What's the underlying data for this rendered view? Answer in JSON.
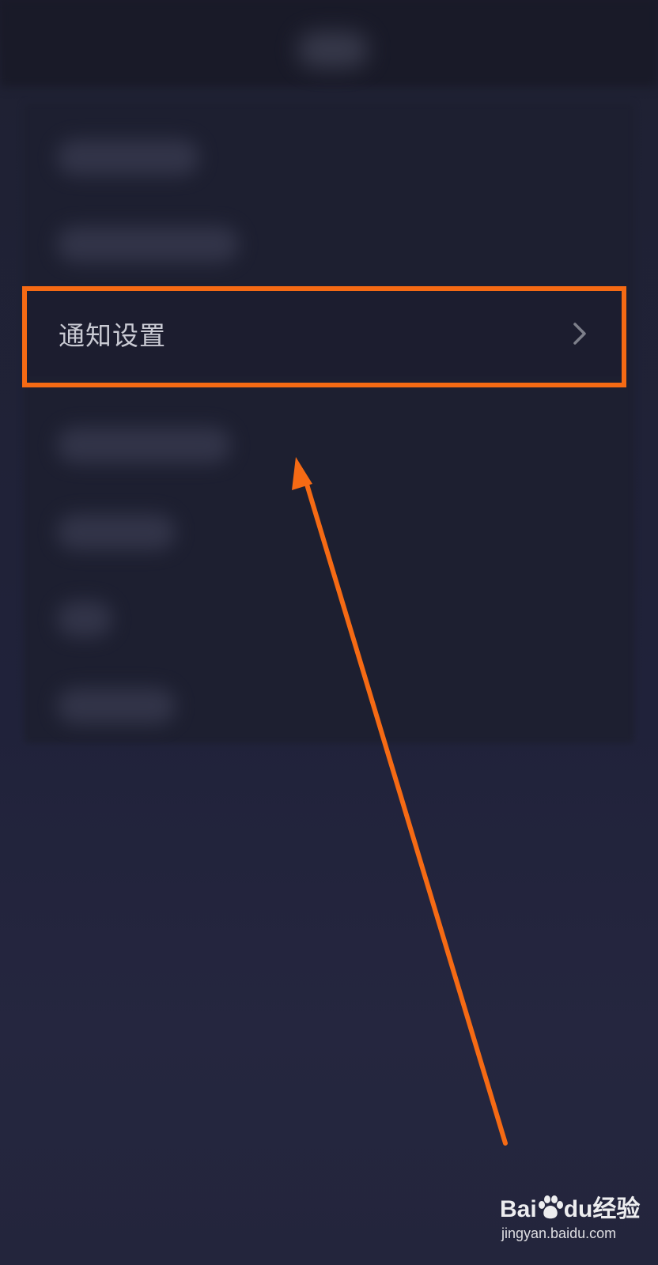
{
  "settings": {
    "notification_item": {
      "label": "通知设置",
      "chevron_icon": "chevron-right-icon"
    }
  },
  "annotation": {
    "highlight_color": "#f56a14",
    "arrow_icon": "arrow-up-icon"
  },
  "watermark": {
    "logo_prefix": "Bai",
    "logo_mid": "du",
    "logo_suffix": "经验",
    "url": "jingyan.baidu.com"
  },
  "colors": {
    "background": "#22243a",
    "row_background": "#1c1d2f",
    "label_text": "#c9cad3",
    "accent": "#f56a14"
  }
}
